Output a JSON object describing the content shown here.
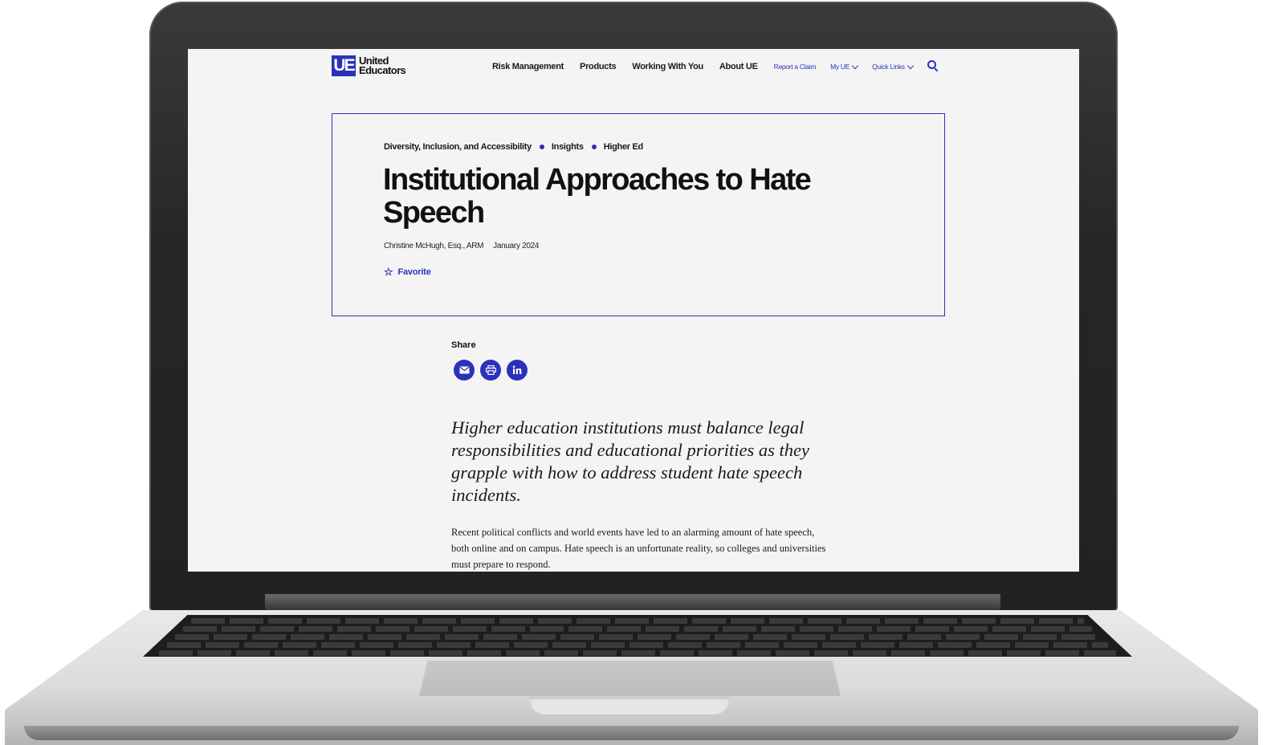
{
  "header": {
    "logo_mark": "UE",
    "logo_line1": "United",
    "logo_line2": "Educators",
    "nav": {
      "risk_management": "Risk Management",
      "products": "Products",
      "working_with_you": "Working With You",
      "about": "About UE",
      "report_claim": "Report a Claim",
      "my_ue": "My UE",
      "quick_links": "Quick Links"
    }
  },
  "article": {
    "breadcrumbs": [
      "Diversity, Inclusion, and Accessibility",
      "Insights",
      "Higher Ed"
    ],
    "title": "Institutional Approaches to Hate Speech",
    "author": "Christine McHugh, Esq., ARM",
    "date": "January 2024",
    "favorite_label": "Favorite",
    "share_label": "Share",
    "lede": "Higher education institutions must balance legal responsibilities and educational priorities as they grapple with how to address student hate speech incidents.",
    "body": "Recent political conflicts and world events have led to an alarming amount of hate speech, both online and on campus. Hate speech is an unfortunate reality, so colleges and universities must prepare to respond."
  },
  "colors": {
    "brand": "#2a33b8",
    "page_background": "#f4f4f4",
    "text": "#111111"
  },
  "icons": [
    "email-icon",
    "print-icon",
    "linkedin-icon",
    "search-icon",
    "star-icon",
    "chevron-down-icon"
  ]
}
